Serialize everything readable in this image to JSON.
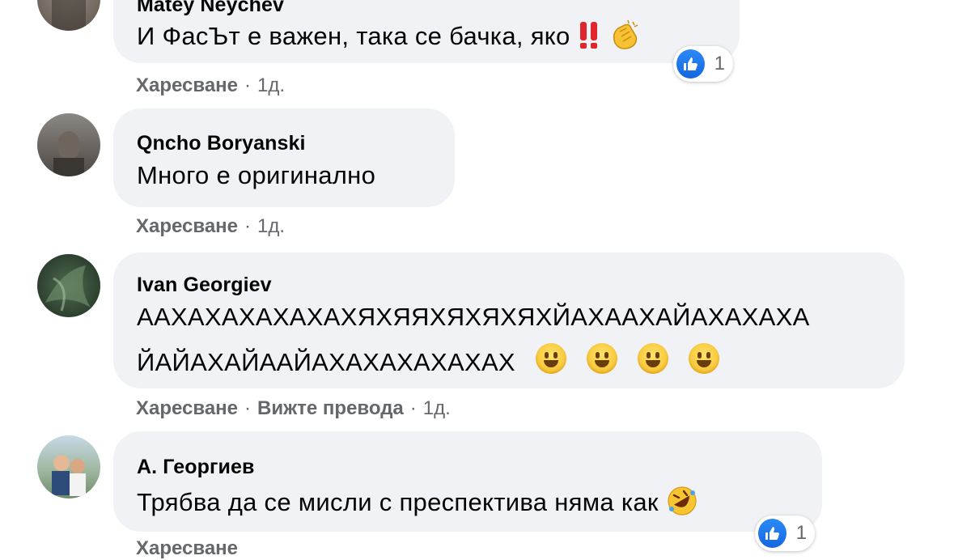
{
  "comments": [
    {
      "author": "Matey Neychev",
      "text": "И ФасЪт е важен, така се бачка, яко",
      "actions": {
        "like": "Харесване",
        "time": "1д."
      },
      "reactions": {
        "count": "1"
      }
    },
    {
      "author": "Qncho Boryanski",
      "text": "Много е оригинално",
      "actions": {
        "like": "Харесване",
        "time": "1д."
      }
    },
    {
      "author": "Ivan Georgiev",
      "text_line1": "ААХАХАХАХАХАХЯХЯЯХЯХЯХЯХЙАХААХАЙАХАХАХА",
      "text_line2": "ЙАЙАХАЙААЙАХАХАХАХАХАХ",
      "actions": {
        "like": "Харесване",
        "translate": "Вижте превода",
        "time": "1д."
      }
    },
    {
      "author": "А. Георгиев",
      "text": "Трябва да се мисли с преспектива няма как",
      "actions": {
        "like": "Харесване"
      },
      "reactions": {
        "count": "1"
      }
    }
  ],
  "separator": "·",
  "icons": {
    "like": "thumbs-up-icon",
    "double-exclamation": "double-exclamation-icon",
    "clapping": "clapping-hands-icon",
    "smiley": "grinning-face-icon",
    "rofl": "rolling-on-floor-laughing-icon"
  },
  "colors": {
    "bubble": "#f0f2f5",
    "meta": "#65676b",
    "like": "#1877f2",
    "text": "#050505"
  }
}
